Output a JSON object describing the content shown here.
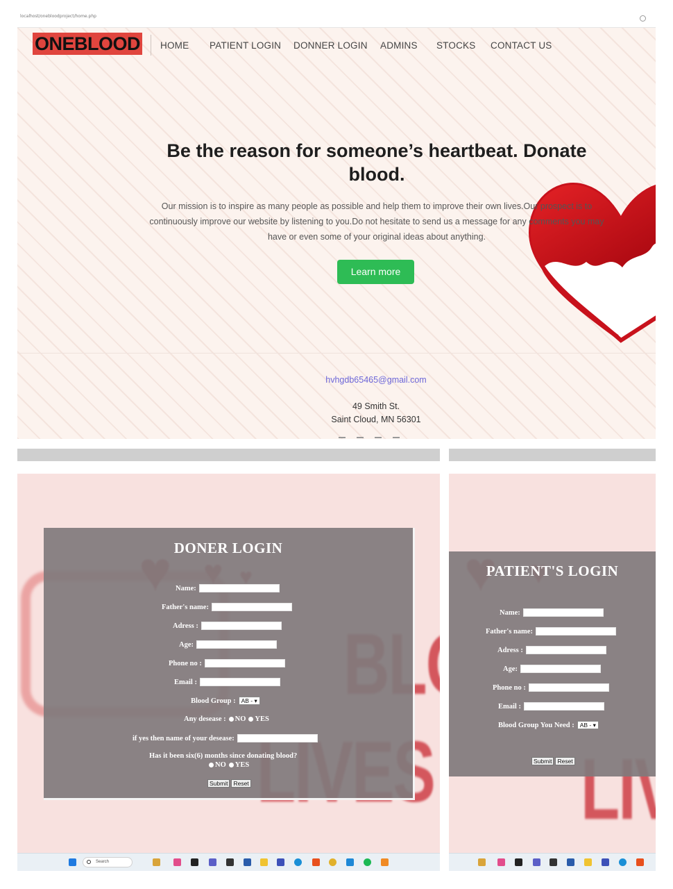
{
  "browser": {
    "url": "localhost/onebloodproject/home.php"
  },
  "nav": {
    "logo": "ONEBLOOD",
    "items": [
      "HOME",
      "PATIENT LOGIN",
      "DONNER LOGIN",
      "ADMINS",
      "STOCKS",
      "CONTACT US"
    ]
  },
  "hero": {
    "title": "Be the reason for someone’s heartbeat. Donate blood.",
    "text": "Our mission is to inspire as many people as possible and help them to improve their own lives.Our prospect is to continuously improve our website by listening to you.Do not hesitate to send us a message for any comments you may have or even some of your original ideas about anything.",
    "button": "Learn more"
  },
  "footer": {
    "email": "hvhgdb65465@gmail.com",
    "address_line1": "49 Smith St.",
    "address_line2": "Saint Cloud, MN 56301"
  },
  "donor_form": {
    "title": "DONER LOGIN",
    "name_label": "Name:",
    "father_label": "Father's name:",
    "address_label": "Adress :",
    "age_label": "Age:",
    "phone_label": "Phone no :",
    "email_label": "Email :",
    "blood_group_label": "Blood Group :",
    "blood_group_value": "AB -",
    "disease_label": "Any desease :",
    "no_label": "NO",
    "yes_label": "YES",
    "disease_name_label": "if yes then name of your desease:",
    "six_months_label": "Has it been six(6) months since donating blood?",
    "submit": "Submit",
    "reset": "Reset"
  },
  "patient_form": {
    "title": "PATIENT'S LOGIN",
    "name_label": "Name:",
    "father_label": "Father's name:",
    "address_label": "Adress :",
    "age_label": "Age:",
    "phone_label": "Phone no :",
    "email_label": "Email :",
    "blood_group_label": "Blood Group You Need :",
    "blood_group_value": "AB -",
    "submit": "Submit",
    "reset": "Reset"
  },
  "taskbar": {
    "search_placeholder": "Search"
  },
  "colors": {
    "logo_bg": "#e0453e",
    "learn_more": "#2ebc55",
    "email_link": "#6d67d8",
    "form_bg": "#807a7c"
  }
}
